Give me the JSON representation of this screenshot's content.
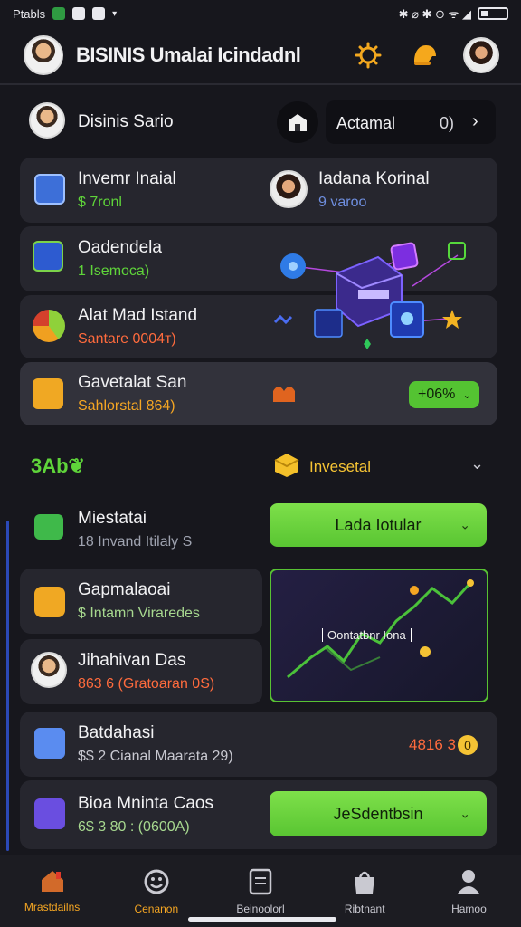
{
  "status": {
    "carrier": "Ptabls",
    "icons_right": "✱ ⌀ ✱ ⊙ ᯤ ◢"
  },
  "header": {
    "title": "BISINIS Umalai Icindadnl"
  },
  "top_card": {
    "name": "Disinis Sario",
    "select_label": "Actamal",
    "select_value": "0)"
  },
  "rows": [
    {
      "title": "Invemr Inaial",
      "sub": "$ 7ronl"
    },
    {
      "title": "Iadana Korinal",
      "sub": "9 varoo"
    },
    {
      "title": "Oadendela",
      "sub": "1 Isemoca)"
    },
    {
      "title": "Alat Mad Istand",
      "sub": "Santare 0004т)"
    },
    {
      "title": "Gavetalat San",
      "sub": "Sahlorstal 864)",
      "badge": "+06%"
    }
  ],
  "section": {
    "label": "3Ab❦",
    "dropdown": "Invesetal"
  },
  "list": [
    {
      "title": "Miestatai",
      "sub": "18 Invand Itilaly S",
      "button": "Lada Iotular"
    },
    {
      "title": "Gapmalaoai",
      "sub": "$ Intamn Viraredes"
    },
    {
      "title": "Jihahivan Das",
      "sub": "863 6 (Gratoaran 0S)"
    },
    {
      "title": "Batdahasi",
      "sub": "$$ 2  Cianal Maarata 29)",
      "amount": "4816 3",
      "amount_coin": "0"
    },
    {
      "title": "Bioa Mninta Caos",
      "sub": "6$ 3 80 : (0600A)",
      "button": "JeSdentbsin"
    }
  ],
  "chart_label": "Oontatbnr Iona",
  "nav": [
    {
      "label": "Mrastdailns",
      "icon": "home-icon"
    },
    {
      "label": "Cenanon",
      "icon": "smile-icon"
    },
    {
      "label": "Beinoolorl",
      "icon": "document-icon"
    },
    {
      "label": "Ribtnant",
      "icon": "bag-icon"
    },
    {
      "label": "Hamoo",
      "icon": "profile-icon"
    }
  ],
  "colors": {
    "accent_green": "#5fd43a",
    "accent_orange": "#ff6b3d",
    "active_nav": "#f5a623",
    "bg": "#17171d",
    "card": "#26262e"
  }
}
